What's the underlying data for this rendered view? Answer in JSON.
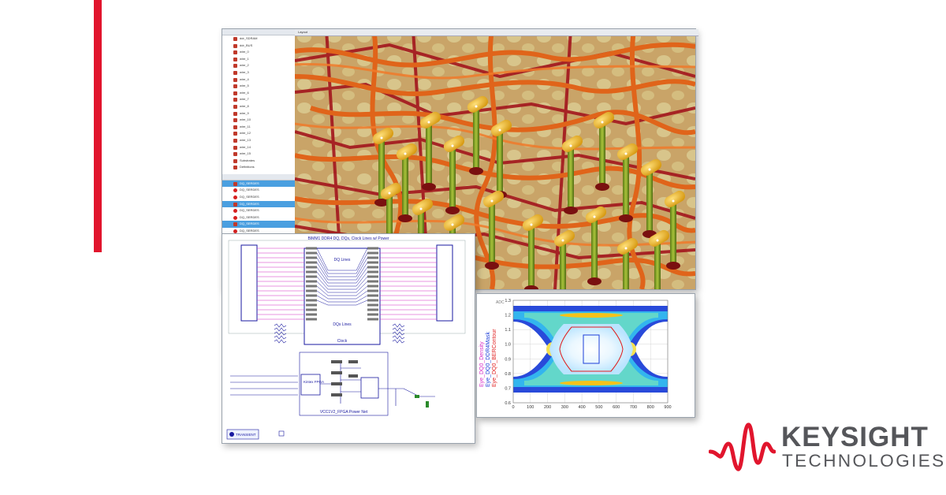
{
  "brand": {
    "line1": "KEYSIGHT",
    "line2": "TECHNOLOGIES",
    "accent_color": "#e1152d",
    "text_color": "#55565a"
  },
  "layout_window": {
    "title": "Layout",
    "tree_items": [
      "ddr_SDRAM",
      "ddr_BUS",
      "wire_0",
      "wire_1",
      "wire_2",
      "wire_3",
      "wire_4",
      "wire_5",
      "wire_6",
      "wire_7",
      "wire_8",
      "wire_9",
      "wire_10",
      "wire_11",
      "wire_12",
      "wire_13",
      "wire_14",
      "wire_15"
    ],
    "tree_groups": [
      "Substrates",
      "Definitions"
    ],
    "net_items": [
      "DQ_SERDES",
      "DQ_SERDES",
      "DQ_SERDES",
      "DQ_SERDES",
      "DQ_SERDES",
      "DQ_SERDES",
      "DQ_SERDES",
      "DQ_SERDES"
    ]
  },
  "schematic": {
    "title": "BIMM1 DDR4 DQ, DQs, Clock Lines w/ Power",
    "block_dq": "DQ Lines",
    "block_dqs": "DQs Lines",
    "block_clock": "Clock",
    "fpga_label": "Kintex FPGA",
    "power_net_label": "VCC1V2_FPGA Power Net",
    "transient_label": "TRANSIENT"
  },
  "eye_diagram": {
    "legend": [
      "Eye_DQ0_Density",
      "Eye_DQ0_DDR4Mask",
      "Eye_DQ0_BERContour"
    ]
  },
  "chart_data": {
    "type": "heatmap",
    "title": "",
    "xlabel": "",
    "ylabel": "",
    "xlim": [
      0,
      900
    ],
    "ylim": [
      0.6,
      1.3
    ],
    "x_ticks": [
      "0",
      "100",
      "200",
      "300",
      "400",
      "500",
      "600",
      "700",
      "800",
      "900"
    ],
    "y_ticks": [
      "0.6",
      "0.7",
      "0.8",
      "0.9",
      "1.0",
      "1.1",
      "1.2",
      "1.3"
    ],
    "y_axis_label_top": "ADC",
    "series": [
      {
        "name": "Eye_DQ0_Density",
        "color": "#d62cc6"
      },
      {
        "name": "Eye_DQ0_DDR4Mask",
        "color": "#1c3ed8"
      },
      {
        "name": "Eye_DQ0_BERContour",
        "color": "#e01d1d"
      }
    ],
    "grid": true
  }
}
